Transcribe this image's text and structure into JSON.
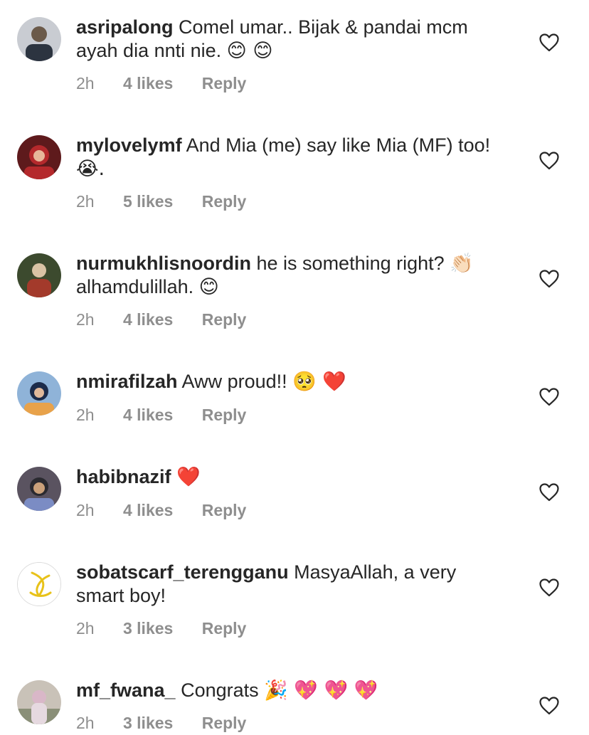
{
  "comments": [
    {
      "username": "asripalong",
      "text": "Comel umar.. Bijak & pandai mcm ayah dia nnti nie.",
      "emoji": "😊 😊",
      "time": "2h",
      "likes": "4 likes",
      "reply": "Reply",
      "avatar_colors": [
        "#2c3440",
        "#6b5a4a",
        "#c9ccd2"
      ]
    },
    {
      "username": "mylovelymf",
      "text": "And Mia (me) say like Mia (MF) too!",
      "emoji": "😭.",
      "time": "2h",
      "likes": "5 likes",
      "reply": "Reply",
      "avatar_colors": [
        "#b4292c",
        "#e7b79a",
        "#5e1a1c"
      ]
    },
    {
      "username": "nurmukhlisnoordin",
      "text": "he is something right?",
      "emoji": "👏🏻",
      "text2": "alhamdulillah.",
      "emoji2": "😊",
      "time": "2h",
      "likes": "4 likes",
      "reply": "Reply",
      "avatar_colors": [
        "#3c4a2e",
        "#a33a2b",
        "#d9c3a5"
      ]
    },
    {
      "username": "nmirafilzah",
      "text": "Aww proud!!",
      "emoji": "🥺 ❤️",
      "time": "2h",
      "likes": "4 likes",
      "reply": "Reply",
      "avatar_colors": [
        "#8fb3d8",
        "#1c2b4a",
        "#e8a24a"
      ]
    },
    {
      "username": "habibnazif",
      "text": "",
      "emoji": "❤️",
      "time": "2h",
      "likes": "4 likes",
      "reply": "Reply",
      "avatar_colors": [
        "#5a5360",
        "#c9a07a",
        "#7b8cc4"
      ]
    },
    {
      "username": "sobatscarf_terengganu",
      "text": "MasyaAllah, a very smart boy!",
      "emoji": "",
      "time": "2h",
      "likes": "3 likes",
      "reply": "Reply",
      "avatar_colors": [
        "#ffffff",
        "#e8c21a",
        "#d0d0d0"
      ]
    },
    {
      "username": "mf_fwana_",
      "text": "Congrats",
      "emoji": "🎉 💖 💖 💖",
      "time": "2h",
      "likes": "3 likes",
      "reply": "Reply",
      "avatar_colors": [
        "#c9c2b8",
        "#d9b7c8",
        "#8a8f78"
      ]
    }
  ],
  "colors": {
    "text": "#262626",
    "meta": "#8e8e8e",
    "heart_stroke": "#262626"
  },
  "icons": {
    "like": "heart-outline-icon"
  }
}
